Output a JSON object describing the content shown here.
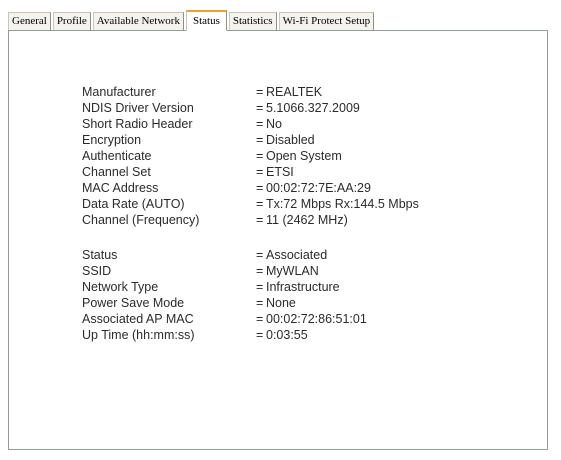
{
  "tabs": [
    {
      "label": "General"
    },
    {
      "label": "Profile"
    },
    {
      "label": "Available Network"
    },
    {
      "label": "Status",
      "active": true
    },
    {
      "label": "Statistics"
    },
    {
      "label": "Wi-Fi Protect Setup"
    }
  ],
  "separator": "=",
  "status_group_1": [
    {
      "label": "Manufacturer",
      "value": "REALTEK"
    },
    {
      "label": "NDIS Driver Version",
      "value": "5.1066.327.2009"
    },
    {
      "label": "Short Radio Header",
      "value": "No"
    },
    {
      "label": "Encryption",
      "value": "Disabled"
    },
    {
      "label": "Authenticate",
      "value": "Open System"
    },
    {
      "label": "Channel Set",
      "value": "ETSI"
    },
    {
      "label": "MAC Address",
      "value": "00:02:72:7E:AA:29"
    },
    {
      "label": "Data Rate (AUTO)",
      "value": "Tx:72 Mbps Rx:144.5 Mbps"
    },
    {
      "label": "Channel (Frequency)",
      "value": "11 (2462 MHz)"
    }
  ],
  "status_group_2": [
    {
      "label": "Status",
      "value": "Associated"
    },
    {
      "label": "SSID",
      "value": "MyWLAN"
    },
    {
      "label": "Network Type",
      "value": "Infrastructure"
    },
    {
      "label": "Power Save Mode",
      "value": "None"
    },
    {
      "label": "Associated AP MAC",
      "value": "00:02:72:86:51:01"
    },
    {
      "label": "Up Time (hh:mm:ss)",
      "value": "0:03:55"
    }
  ]
}
